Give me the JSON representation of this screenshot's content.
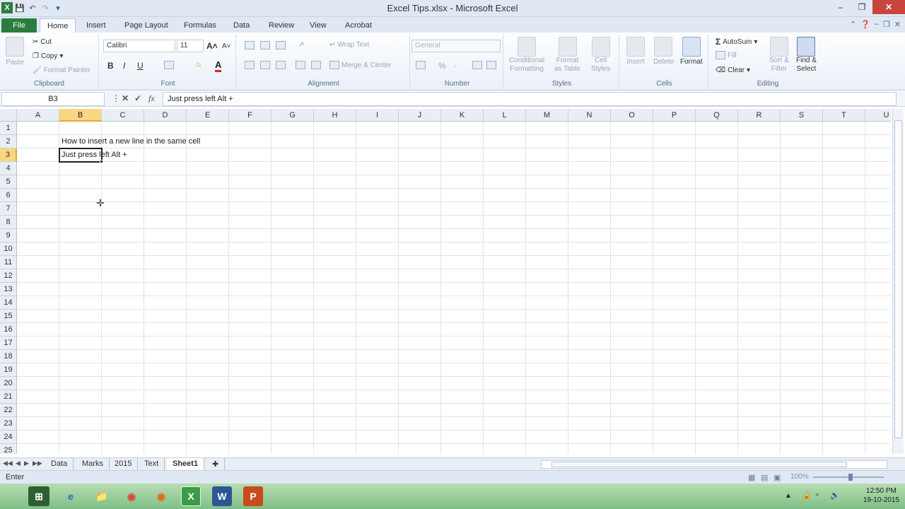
{
  "window": {
    "title": "Excel Tips.xlsx - Microsoft Excel"
  },
  "ribbon_tabs": [
    "File",
    "Home",
    "Insert",
    "Page Layout",
    "Formulas",
    "Data",
    "Review",
    "View",
    "Acrobat"
  ],
  "clipboard": {
    "paste": "Paste",
    "cut": "Cut",
    "copy": "Copy",
    "format_painter": "Format Painter",
    "label": "Clipboard"
  },
  "font": {
    "name": "Calibri",
    "size": "11",
    "label": "Font",
    "bold": "B",
    "italic": "I",
    "underline": "U"
  },
  "alignment": {
    "wrap_text": "Wrap Text",
    "merge_center": "Merge & Center",
    "label": "Alignment"
  },
  "number": {
    "format": "General",
    "percent": "%",
    "label": "Number"
  },
  "styles": {
    "conditional": [
      "Conditional",
      "Formatting"
    ],
    "format_table": [
      "Format",
      "as Table"
    ],
    "cell_styles": [
      "Cell",
      "Styles"
    ],
    "label": "Styles"
  },
  "cells": {
    "insert": "Insert",
    "delete": "Delete",
    "format": "Format",
    "label": "Cells"
  },
  "editing": {
    "autosum": "AutoSum",
    "fill": "Fill",
    "clear": "Clear",
    "sort_filter": [
      "Sort &",
      "Filter"
    ],
    "find_select": [
      "Find &",
      "Select"
    ],
    "label": "Editing"
  },
  "formula_bar": {
    "name_box": "B3",
    "content": "Just press left Alt +",
    "fx": "fx"
  },
  "columns": [
    "A",
    "B",
    "C",
    "D",
    "E",
    "F",
    "G",
    "H",
    "I",
    "J",
    "K",
    "L",
    "M",
    "N",
    "O",
    "P",
    "Q",
    "R",
    "S",
    "T",
    "U"
  ],
  "rows": [
    "1",
    "2",
    "3",
    "4",
    "5",
    "6",
    "7",
    "8",
    "9",
    "10",
    "11",
    "12",
    "13",
    "14",
    "15",
    "16",
    "17",
    "18",
    "19",
    "20",
    "21",
    "22",
    "23",
    "24",
    "25"
  ],
  "selected_column": "B",
  "selected_row": "3",
  "cell_values": {
    "B2": "How to insert a new line in the same cell",
    "B3": "Just press left Alt +"
  },
  "sheets": [
    "Data",
    "Marks",
    "2015",
    "Text",
    "Sheet1"
  ],
  "active_sheet": "Sheet1",
  "status": {
    "mode": "Enter",
    "zoom": "100%"
  },
  "clock": {
    "time": "12:50 PM",
    "date": "19-10-2015"
  }
}
